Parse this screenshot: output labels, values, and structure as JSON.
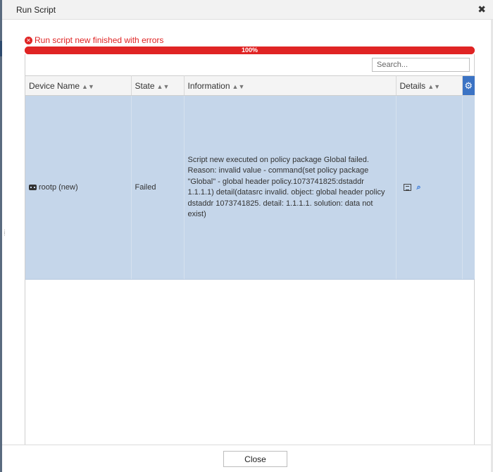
{
  "dialog": {
    "title": "Run Script",
    "close_glyph": "✖"
  },
  "status": {
    "icon": "error-circle-icon",
    "message": "Run script new finished with errors",
    "color": "#e02424"
  },
  "progress": {
    "value": 1.0,
    "label": "100%"
  },
  "search": {
    "placeholder": "Search..."
  },
  "table": {
    "columns": [
      "Device Name",
      "State",
      "Information",
      "Details"
    ],
    "rows": [
      {
        "device": "rootp (new)",
        "state": "Failed",
        "information": "Script new executed on policy package Global failed. Reason: invalid value - command(set policy package \"Global\" - global header policy.1073741825:dstaddr 1.1.1.1) detail(datasrc invalid. object: global header policy dstaddr 1073741825. detail: 1.1.1.1. solution: data not exist)"
      }
    ]
  },
  "footer": {
    "close_label": "Close"
  },
  "colors": {
    "accent": "#3b73c4",
    "row_selected": "#c5d6ea",
    "error": "#e02424"
  }
}
